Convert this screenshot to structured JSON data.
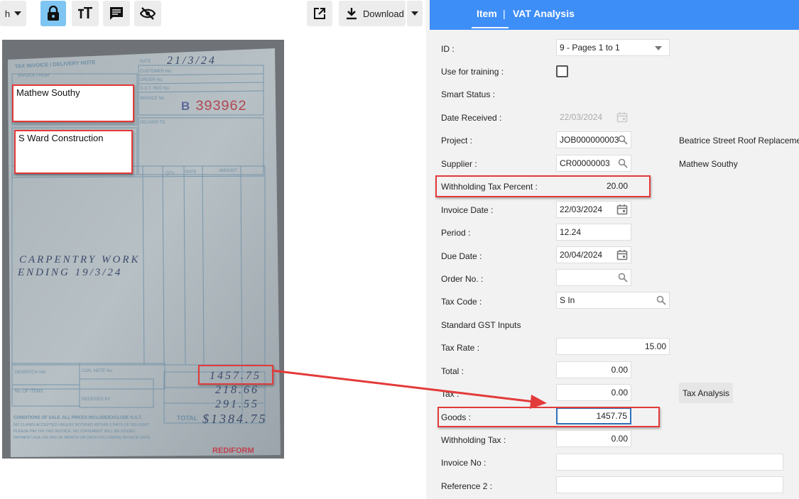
{
  "toolbar": {
    "partial_label": "h",
    "download_label": "Download",
    "icons": [
      "chevron-down-icon",
      "lock-icon",
      "text-size-icon",
      "comment-icon",
      "eye-off-icon",
      "open-external-icon",
      "download-icon",
      "chevron-down-icon"
    ]
  },
  "document": {
    "title": "TAX INVOICE / DELIVERY NOTE",
    "date_label": "DATE",
    "date_value": "21/3/24",
    "customer_no_label": "CUSTOMER No.",
    "order_no_label": "ORDER No.",
    "gst_label": "G.S.T. REG No.",
    "invoice_no_label": "INVOICE No.",
    "invoice_prefix": "B",
    "invoice_number": "393962",
    "invoice_from_label": "INVOICE FROM",
    "deliver_to_label": "DELIVER TO",
    "qty_label": "QTY.",
    "rate_label": "RATE",
    "amount_label": "AMOUNT",
    "line1": "CARPENTRY WORK",
    "line2": "ENDING 19/3/24",
    "despatch_label": "DESPATCH VIA",
    "con_note_label": "CON. NOTE No.",
    "items_label": "No. OF ITEMS",
    "received_label": "RECEIVED BY",
    "total_label": "TOTAL",
    "amount1": "1457.75",
    "amount2": "218.66",
    "amount3": "291.55",
    "total_value": "$1384.75",
    "brand": "REDIFORM",
    "conditions": "CONDITIONS OF SALE. ALL PRICES INCLUDE/EXCLUDE G.S.T."
  },
  "annotations": {
    "supplier_box": "Mathew Southy",
    "customer_box": "S Ward Construction"
  },
  "tabs": {
    "item": "Item",
    "separator": "|",
    "vat": "VAT Analysis"
  },
  "form": {
    "id_label": "ID :",
    "id_value": "9 - Pages 1 to 1",
    "training_label": "Use for training :",
    "smart_status_label": "Smart Status :",
    "date_received_label": "Date Received :",
    "date_received_value": "22/03/2024",
    "project_label": "Project :",
    "project_value": "JOB000000003",
    "project_name": "Beatrice Street Roof Replacement",
    "supplier_label": "Supplier :",
    "supplier_value": "CR00000003",
    "supplier_name": "Mathew Southy",
    "wht_percent_label": "Withholding Tax Percent :",
    "wht_percent_value": "20.00",
    "invoice_date_label": "Invoice Date :",
    "invoice_date_value": "22/03/2024",
    "period_label": "Period :",
    "period_value": "12.24",
    "due_date_label": "Due Date :",
    "due_date_value": "20/04/2024",
    "order_no_label": "Order No. :",
    "order_no_value": "",
    "tax_code_label": "Tax Code :",
    "tax_code_value": "S In",
    "tax_code_desc": "Standard GST Inputs",
    "tax_rate_label": "Tax Rate :",
    "tax_rate_value": "15.00",
    "total_label": "Total :",
    "total_value": "0.00",
    "tax_label": "Tax :",
    "tax_value": "0.00",
    "tax_analysis_button": "Tax Analysis",
    "goods_label": "Goods :",
    "goods_value": "1457.75",
    "wht_label": "Withholding Tax :",
    "wht_value": "0.00",
    "invoice_no_label": "Invoice No :",
    "invoice_no_value": "",
    "ref2_label": "Reference 2 :",
    "ref2_value": ""
  },
  "colors": {
    "header_blue": "#3E8EF7",
    "highlight_red": "#E33A3A",
    "active_button": "#7FC5F2",
    "panel_bg": "#F2F2F2"
  }
}
